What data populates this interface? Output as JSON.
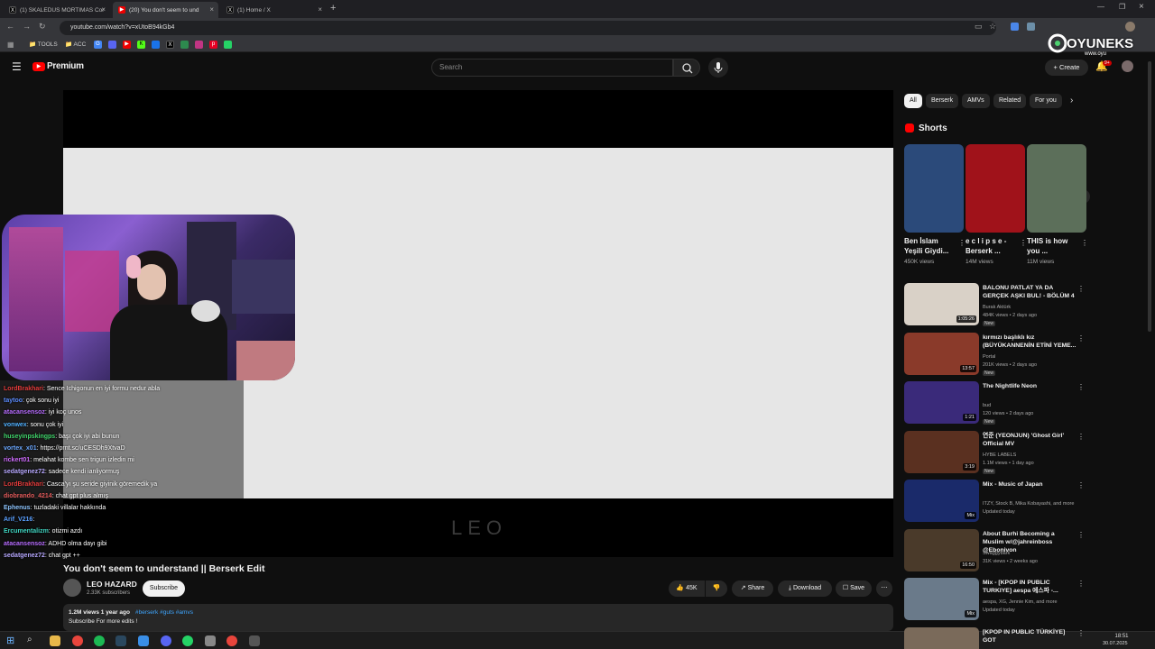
{
  "browser": {
    "tabs": [
      {
        "title": "(1) SKALEDUS MORTIMAS Cor"
      },
      {
        "title": "(20) You don't seem to und"
      },
      {
        "title": "(1) Home / X"
      }
    ],
    "url": "youtube.com/watch?v=xUtoB94kGb4",
    "bookmarks": [
      "TOOLS",
      "ACC"
    ]
  },
  "watermark": {
    "brand": "OYUNEKS",
    "domain": "www.oyu"
  },
  "yt": {
    "logo": "Premium",
    "search_placeholder": "Search",
    "create_label": "Create",
    "notif_count": "9+"
  },
  "video": {
    "overlay_text": "LEO",
    "title": "You don't seem to understand || Berserk Edit",
    "channel": "LEO HAZARD",
    "subscribers": "2.33K subscribers",
    "subscribe_label": "Subscribe",
    "likes": "45K",
    "share_label": "Share",
    "download_label": "Download",
    "save_label": "Save",
    "views_line": "1.2M views  1 year ago",
    "tags": "#berserk #guts #amvs",
    "description": "Subscribe For more edits !"
  },
  "chat": [
    {
      "user": "LordBrakhari",
      "color": "#e23b3b",
      "msg": ": Sence Ichigonun en iyi formu nedur abla"
    },
    {
      "user": "taytoo",
      "color": "#5b8cff",
      "msg": ": çok sonu iyi"
    },
    {
      "user": "atacansensoz",
      "color": "#b76cff",
      "msg": ": iyi koç unos"
    },
    {
      "user": "vonwex",
      "color": "#4fb0ff",
      "msg": ": sonu çok iyi"
    },
    {
      "user": "huseyinpskingps",
      "color": "#3fd46a",
      "msg": ": başı çok iyi abi bunun"
    },
    {
      "user": "vortex_x01",
      "color": "#6aa7ff",
      "msg": ": https://prnt.sc/uCESDh9XtvaD"
    },
    {
      "user": "rickert01",
      "color": "#d06cff",
      "msg": ": melahat kombe sen trigun izledin mi"
    },
    {
      "user": "sedatgenez72",
      "color": "#b7a8ff",
      "msg": ": sadece kendi ianliyormuş"
    },
    {
      "user": "LordBrakhari",
      "color": "#e23b3b",
      "msg": ": Casca'yı şu seride giyinik göremedik ya"
    },
    {
      "user": "diobrando_4214",
      "color": "#e25a5a",
      "msg": ": chat gpt plus almış"
    },
    {
      "user": "Ephenus",
      "color": "#8ec6ff",
      "msg": ": tuzladaki villalar hakkında"
    },
    {
      "user": "Arif_V216",
      "color": "#5aa0ff",
      "msg": ":"
    },
    {
      "user": "Ercumentalizm",
      "color": "#3fd4c0",
      "msg": ": otizmi azdı"
    },
    {
      "user": "atacansensoz",
      "color": "#b76cff",
      "msg": ": ADHD olma dayı gibi"
    },
    {
      "user": "sedatgenez72",
      "color": "#b7a8ff",
      "msg": ": chat gpt ++"
    }
  ],
  "chips": [
    "All",
    "Berserk",
    "AMVs",
    "Related",
    "For you"
  ],
  "shorts": {
    "heading": "Shorts",
    "items": [
      {
        "title": "Ben İslam Yeşili Giydi...",
        "views": "450K views",
        "color": "#2b4a7a"
      },
      {
        "title": "e c l i p s e - Berserk ...",
        "views": "14M views",
        "color": "#a0121a"
      },
      {
        "title": "THIS is how you ...",
        "views": "11M views",
        "color": "#5c6f5a"
      }
    ]
  },
  "recs": [
    {
      "title": "BALONU PATLAT YA DA GERÇEK AŞKI BUL! - BÖLÜM 4",
      "channel": "Burak Aktürk",
      "meta": "484K views • 2 days ago",
      "dur": "1:05:26",
      "new": "New",
      "color": "#d9d1c7"
    },
    {
      "title": "kırmızı başlıklı kız (BÜYÜKANNENİN ETİNİ YEME...",
      "channel": "Portal",
      "meta": "201K views • 2 days ago",
      "dur": "13:57",
      "new": "New",
      "color": "#8a3a2a"
    },
    {
      "title": "The Nightlife Neon",
      "channel": "bud",
      "meta": "120 views • 2 days ago",
      "dur": "1:21",
      "new": "New",
      "color": "#3a2a7a"
    },
    {
      "title": "연준 (YEONJUN) 'Ghost Girl' Official MV",
      "channel": "HYBE LABELS",
      "meta": "1.1M views • 1 day ago",
      "dur": "3:19",
      "new": "New",
      "color": "#5a3020"
    },
    {
      "title": "Mix - Music of Japan",
      "channel": "ITZY, Stock B, Mika Kobayashi, and more",
      "meta": "Updated today",
      "dur": "Mix",
      "new": "",
      "color": "#1a2a6a"
    },
    {
      "title": "About Burhi Becoming a Muslim w/@jahreinboss @Ebonivon",
      "channel": "Swaggybark",
      "meta": "31K views • 2 weeks ago",
      "dur": "16:50",
      "new": "",
      "color": "#4a3a2a"
    },
    {
      "title": "Mix - [KPOP IN PUBLIC TURKIYE] aespa 에스파 -...",
      "channel": "aespa, XG, Jennie Kim, and more",
      "meta": "Updated today",
      "dur": "Mix",
      "new": "",
      "color": "#6a7a8a"
    },
    {
      "title": "[KPOP IN PUBLIC TÜRKİYE] GOT",
      "channel": "",
      "meta": "",
      "dur": "",
      "new": "",
      "color": "#7a6a5a"
    }
  ],
  "taskbar": {
    "time": "18:51",
    "date": "30.07.2025"
  }
}
